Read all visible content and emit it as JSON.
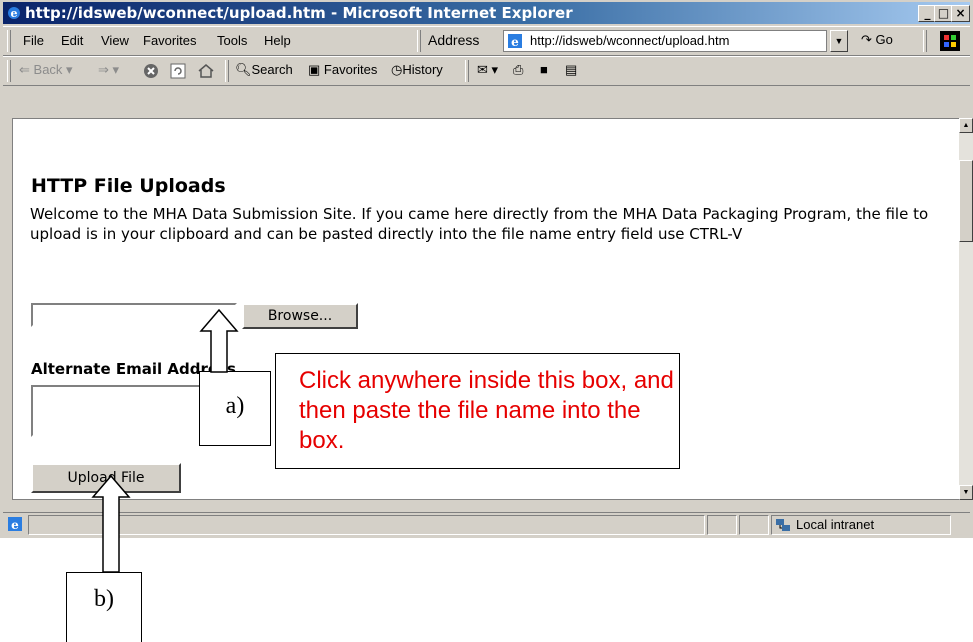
{
  "window": {
    "title": "http://idsweb/wconnect/upload.htm - Microsoft Internet Explorer",
    "min": "_",
    "max": "□",
    "close": "×"
  },
  "menu": [
    "File",
    "Edit",
    "View",
    "Favorites",
    "Tools",
    "Help"
  ],
  "address": {
    "label": "Address",
    "url": "http://idsweb/wconnect/upload.htm",
    "go_label": "Go"
  },
  "nav": {
    "back": "Back",
    "search": "Search",
    "favorites": "Favorites",
    "history": "History"
  },
  "page": {
    "title": "HTTP File Uploads",
    "welcome": "Welcome to the MHA Data Submission Site. If you came here directly from the MHA Data Packaging Program, the file to upload is in your clipboard and can be pasted directly into the file name entry field use CTRL-V",
    "browse_label": "Browse...",
    "alt_email_label": "Alternate Email Address",
    "upload_label": "Upload File"
  },
  "status": {
    "zone": "Local intranet"
  },
  "annotations": {
    "a_label": "a)",
    "b_label": "b)",
    "instruction": "Click anywhere inside this box, and then paste the file name  into the box."
  },
  "colors": {
    "title_start": "#0a246a",
    "title_end": "#a6caf0",
    "callout_text": "#e60000",
    "chrome": "#d4d0c8"
  },
  "icons": [
    "ie-logo-icon",
    "page-icon",
    "go-arrow-icon",
    "windows-logo-icon",
    "back-arrow-icon",
    "forward-arrow-icon",
    "stop-icon",
    "refresh-icon",
    "home-icon",
    "search-icon",
    "favorites-icon",
    "history-icon",
    "mail-icon",
    "print-icon",
    "edit-icon",
    "discuss-icon",
    "intranet-icon",
    "up-arrow-icon"
  ]
}
